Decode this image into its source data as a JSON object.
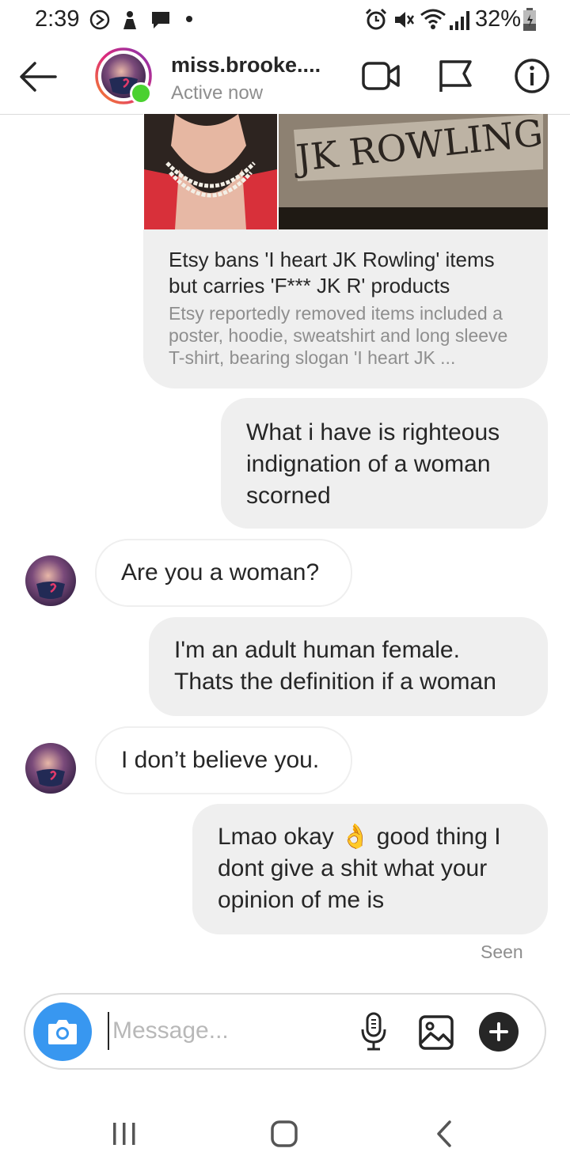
{
  "status_bar": {
    "time": "2:39",
    "battery": "32%",
    "icons": [
      "data-saver-icon",
      "notification-icon",
      "chat-notification-icon",
      "dot-icon",
      "alarm-icon",
      "mute-icon",
      "wifi-icon",
      "signal-icon",
      "battery-icon"
    ]
  },
  "header": {
    "username": "miss.brooke....",
    "activity": "Active now",
    "icons": [
      "back-arrow-icon",
      "video-call-icon",
      "flag-icon",
      "info-icon"
    ]
  },
  "link_card": {
    "title": "Etsy bans 'I heart JK Rowling' items but carries 'F*** JK R' products",
    "description": "Etsy reportedly removed items included a poster, hoodie, sweatshirt and long sleeve T-shirt, bearing slogan 'I heart JK ...",
    "image_text": "JK ROWLING"
  },
  "messages": [
    {
      "from": "me",
      "text": "What i have is righteous indignation of a woman scorned"
    },
    {
      "from": "them",
      "text": "Are you a woman?"
    },
    {
      "from": "me",
      "text": "I'm an adult human female. Thats the definition if a woman"
    },
    {
      "from": "them",
      "text": "I don’t believe you."
    },
    {
      "from": "me",
      "text": "Lmao okay 👌 good thing I dont give a shit what your opinion of me is"
    }
  ],
  "seen_label": "Seen",
  "composer": {
    "placeholder": "Message...",
    "icons": [
      "camera-icon",
      "microphone-icon",
      "gallery-icon",
      "plus-icon"
    ]
  },
  "nav_bar": {
    "icons": [
      "recent-apps-icon",
      "home-icon",
      "back-icon"
    ]
  },
  "colors": {
    "accent_blue": "#3897f0",
    "online_green": "#4ad130",
    "bubble_gray": "#efefef"
  }
}
